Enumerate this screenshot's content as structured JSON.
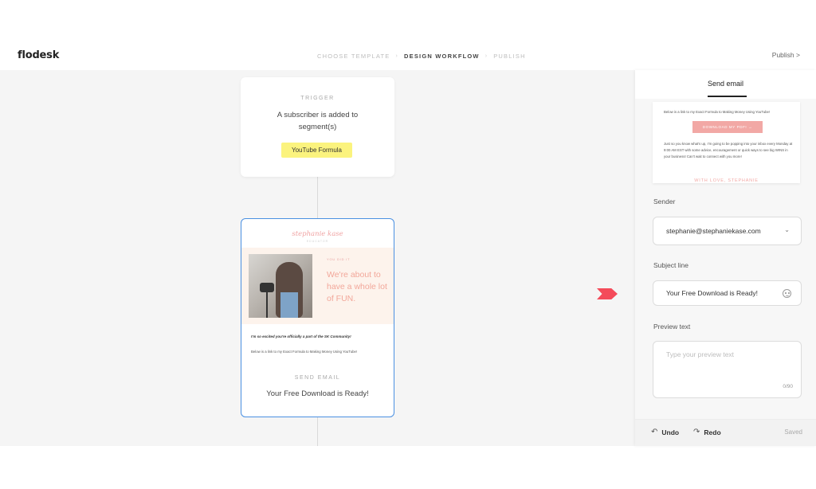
{
  "header": {
    "logo": "flodesk",
    "steps": [
      {
        "label": "CHOOSE TEMPLATE",
        "active": false
      },
      {
        "label": "DESIGN WORKFLOW",
        "active": true
      },
      {
        "label": "PUBLISH",
        "active": false
      }
    ],
    "step_separator": "›",
    "publish_label": "Publish >"
  },
  "trigger": {
    "kicker": "TRIGGER",
    "text": "A subscriber is added to segment(s)",
    "segment": "YouTube Formula"
  },
  "email_step": {
    "brand": "stephanie kase",
    "brand_sub": "EDUCATOR",
    "hero_kicker": "YOU DID IT",
    "hero_headline": "We're about to have a whole lot of FUN.",
    "line1": "I'm so excited you're officially a part of the SK Community!",
    "line2": "Below is a link to my Exact Formula to Making Money Using YouTube!",
    "kicker": "SEND EMAIL",
    "subject": "Your Free Download is Ready!"
  },
  "panel": {
    "tab": "Send email",
    "preview": {
      "line1": "Below is a link to my Exact Formula to Making Money Using YouTube!",
      "button": "DOWNLOAD MY PDF! →",
      "paragraph": "Just so you know what's up, I'm going to be popping into your inbox every Monday at 9:00 AM EST with some advice, encouragement or quick ways to see big WINS in your business! Can't wait to connect with you more!",
      "signoff": "WITH LOVE, STEPHANIE"
    },
    "sender": {
      "label": "Sender",
      "value": "stephanie@stephaniekase.com"
    },
    "subject": {
      "label": "Subject line",
      "value": "Your Free Download is Ready!"
    },
    "preview_text": {
      "label": "Preview text",
      "placeholder": "Type your preview text",
      "counter": "0/90"
    },
    "footer": {
      "undo": "Undo",
      "redo": "Redo",
      "status": "Saved"
    }
  },
  "colors": {
    "accent": "#4a90e2",
    "segment_chip": "#fbf37e",
    "marker": "#f44b5a",
    "brand_pink": "#f2a8a5"
  }
}
